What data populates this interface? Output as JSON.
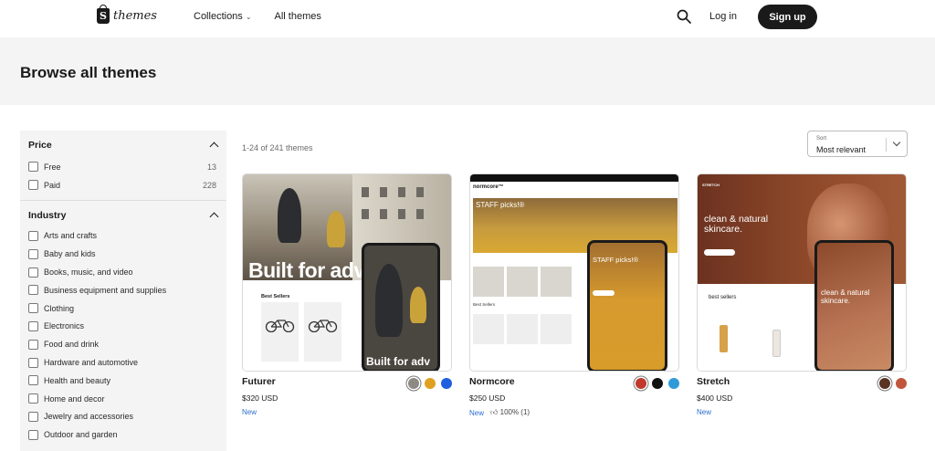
{
  "header": {
    "logo_text": "themes",
    "nav": [
      {
        "label": "Collections"
      },
      {
        "label": "All themes"
      }
    ],
    "login_label": "Log in",
    "signup_label": "Sign up"
  },
  "hero": {
    "title": "Browse all themes"
  },
  "filters": {
    "price": {
      "title": "Price",
      "options": [
        {
          "label": "Free",
          "count": "13"
        },
        {
          "label": "Paid",
          "count": "228"
        }
      ]
    },
    "industry": {
      "title": "Industry",
      "options": [
        {
          "label": "Arts and crafts"
        },
        {
          "label": "Baby and kids"
        },
        {
          "label": "Books, music, and video"
        },
        {
          "label": "Business equipment and supplies"
        },
        {
          "label": "Clothing"
        },
        {
          "label": "Electronics"
        },
        {
          "label": "Food and drink"
        },
        {
          "label": "Hardware and automotive"
        },
        {
          "label": "Health and beauty"
        },
        {
          "label": "Home and decor"
        },
        {
          "label": "Jewelry and accessories"
        },
        {
          "label": "Outdoor and garden"
        }
      ]
    }
  },
  "results": {
    "summary": "1-24 of 241 themes"
  },
  "sort": {
    "label": "Sort",
    "value": "Most relevant"
  },
  "themes": [
    {
      "name": "Futurer",
      "price": "$320 USD",
      "badge": "New",
      "swatches": [
        "#8d8a84",
        "#e0a021",
        "#1f5fe0"
      ],
      "preview": {
        "headline": "Built for adv",
        "phone_headline": "Built for adv",
        "section": "Best Sellers"
      }
    },
    {
      "name": "Normcore",
      "price": "$250 USD",
      "badge": "New",
      "rating": "100% (1)",
      "swatches": [
        "#c0392b",
        "#111111",
        "#2f9ad8"
      ],
      "preview": {
        "brand": "normcore™",
        "headline": "STAFF picks!®",
        "phone_headline": "STAFF picks!®",
        "section": "Best Sellers"
      }
    },
    {
      "name": "Stretch",
      "price": "$400 USD",
      "badge": "New",
      "swatches": [
        "#5a3324",
        "#c0563b"
      ],
      "preview": {
        "brand": "STRETCH",
        "headline": "clean & natural skincare.",
        "phone_headline": "clean & natural skincare.",
        "section": "best sellers"
      }
    }
  ],
  "colors": {
    "accent_dark": "#1a1a1a",
    "link_blue": "#2c6ecb",
    "panel_gray": "#f4f4f4"
  }
}
